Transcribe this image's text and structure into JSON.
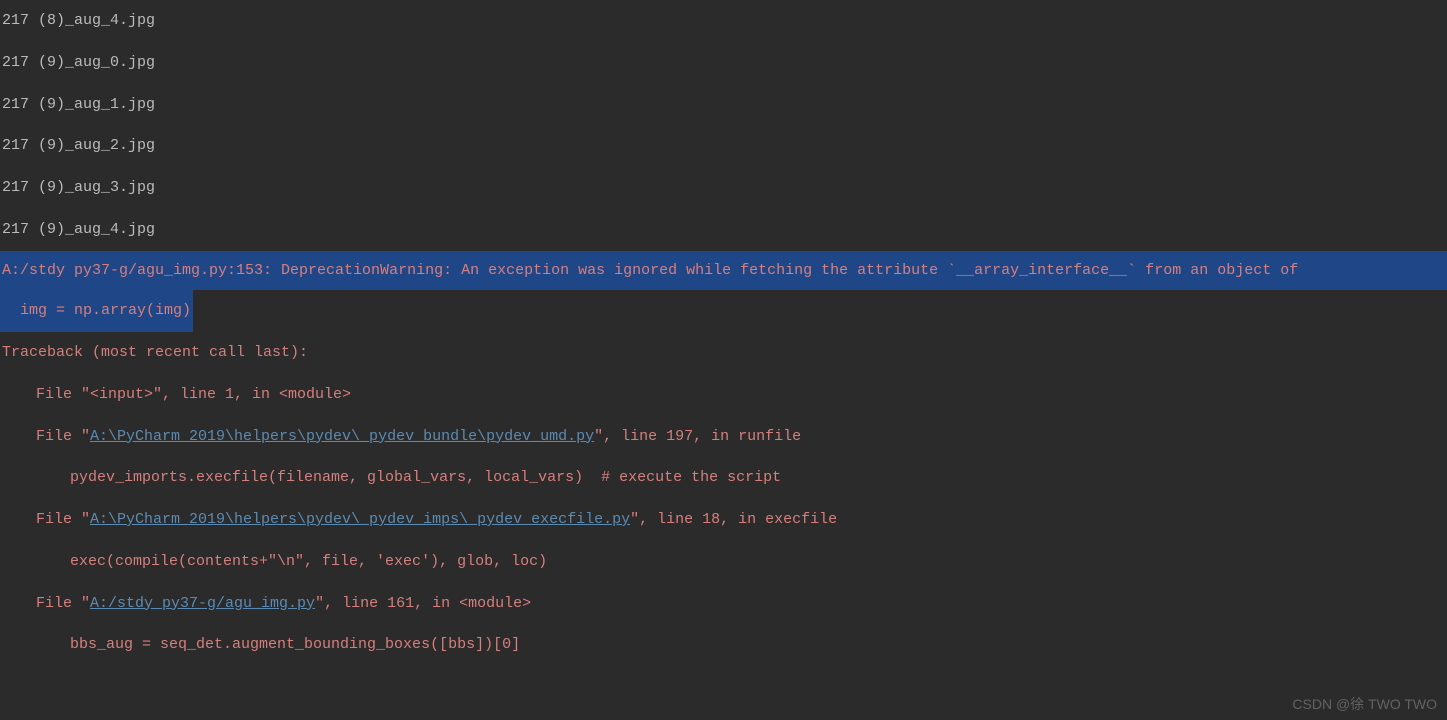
{
  "output": {
    "file_lines": [
      "217 (8)_aug_4.jpg",
      "217 (9)_aug_0.jpg",
      "217 (9)_aug_1.jpg",
      "217 (9)_aug_2.jpg",
      "217 (9)_aug_3.jpg",
      "217 (9)_aug_4.jpg"
    ],
    "warning": {
      "line1": "A:/stdy py37-g/agu_img.py:153: DeprecationWarning: An exception was ignored while fetching the attribute `__array_interface__` from an object of ",
      "line2": "  img = np.array(img)"
    },
    "traceback": {
      "header": "Traceback (most recent call last):",
      "frames": [
        {
          "prefix": "  File \"",
          "path": "<input>",
          "path_is_link": false,
          "suffix": "\", line 1, in <module>",
          "code": null
        },
        {
          "prefix": "  File \"",
          "path": "A:\\PyCharm 2019\\helpers\\pydev\\_pydev_bundle\\pydev_umd.py",
          "path_is_link": true,
          "suffix": "\", line 197, in runfile",
          "code": "    pydev_imports.execfile(filename, global_vars, local_vars)  # execute the script"
        },
        {
          "prefix": "  File \"",
          "path": "A:\\PyCharm 2019\\helpers\\pydev\\_pydev_imps\\_pydev_execfile.py",
          "path_is_link": true,
          "suffix": "\", line 18, in execfile",
          "code": "    exec(compile(contents+\"\\n\", file, 'exec'), glob, loc)"
        },
        {
          "prefix": "  File \"",
          "path": "A:/stdy py37-g/agu_img.py",
          "path_is_link": true,
          "suffix": "\", line 161, in <module>",
          "code": "    bbs_aug = seq_det.augment_bounding_boxes([bbs])[0]"
        }
      ]
    }
  },
  "watermark": "CSDN @徐 TWO TWO"
}
